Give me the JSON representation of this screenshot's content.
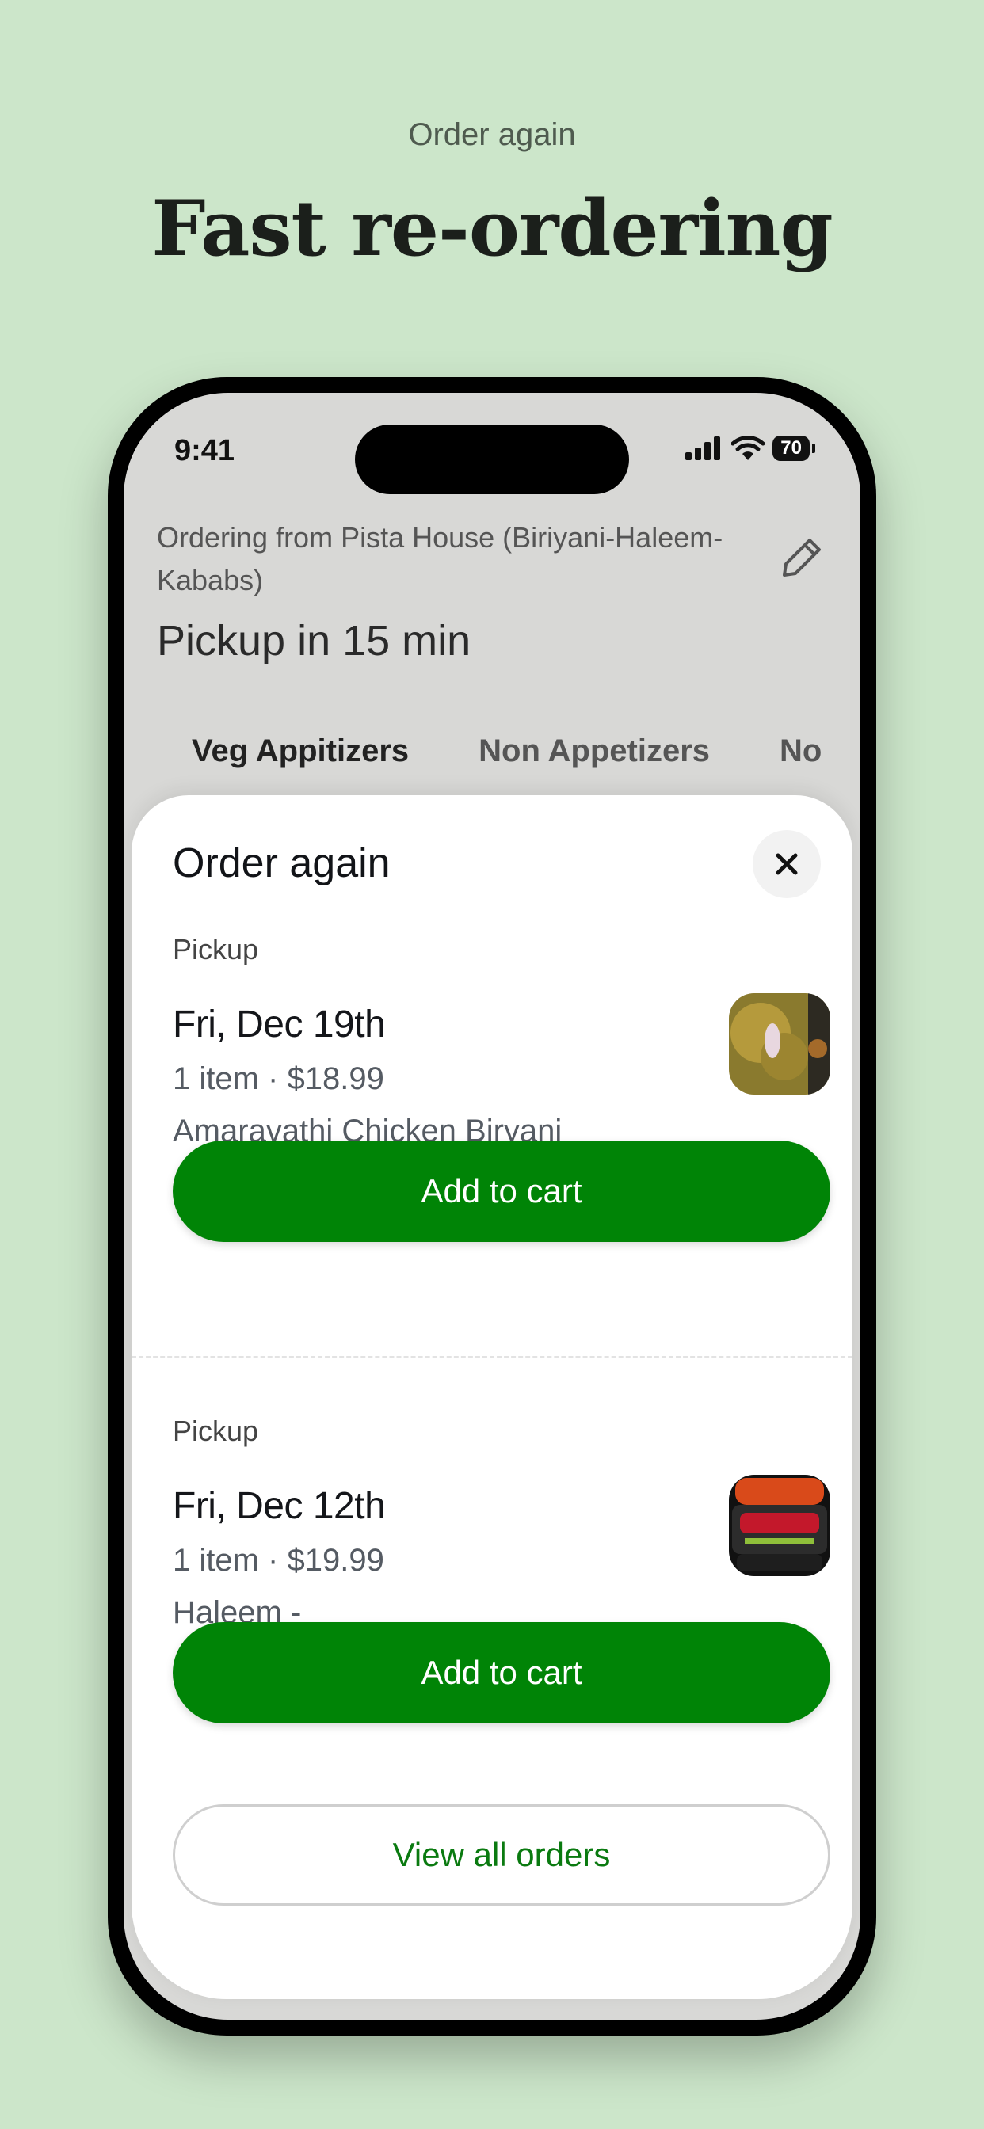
{
  "promo": {
    "eyebrow": "Order again",
    "headline": "Fast re-ordering"
  },
  "status_bar": {
    "time": "9:41",
    "battery": "70",
    "icons": [
      "signal-icon",
      "wifi-icon",
      "battery-icon"
    ]
  },
  "store_header": {
    "ordering_from": "Ordering from Pista House (Biriyani-Haleem-Kababs)",
    "pickup_eta": "Pickup in 15 min",
    "edit_icon": "pencil-icon"
  },
  "menu_tabs": [
    {
      "label": "Veg Appitizers",
      "active": true
    },
    {
      "label": "Non Appetizers",
      "active": false
    },
    {
      "label": "No",
      "active": false
    }
  ],
  "sheet": {
    "title": "Order again",
    "close_icon": "close-icon",
    "view_all_label": "View all orders",
    "orders": [
      {
        "mode": "Pickup",
        "date": "Fri, Dec 19th",
        "summary": "1 item · $18.99",
        "item_name": "Amaravathi Chicken Biryani",
        "button_label": "Add to cart"
      },
      {
        "mode": "Pickup",
        "date": "Fri, Dec 12th",
        "summary": "1 item · $19.99",
        "item_name": "Haleem -",
        "button_label": "Add to cart"
      }
    ]
  },
  "colors": {
    "background": "#cce6ca",
    "accent_green": "#008406",
    "text_dark": "#14161a"
  }
}
